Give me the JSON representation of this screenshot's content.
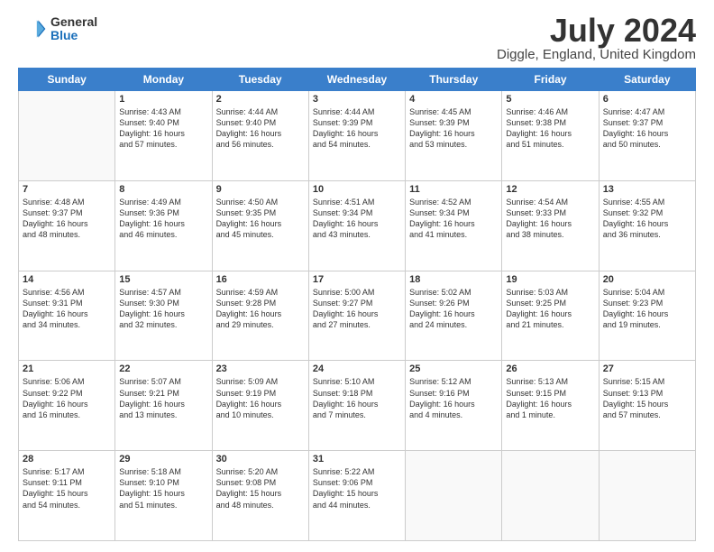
{
  "header": {
    "logo_general": "General",
    "logo_blue": "Blue",
    "title": "July 2024",
    "location": "Diggle, England, United Kingdom"
  },
  "days_of_week": [
    "Sunday",
    "Monday",
    "Tuesday",
    "Wednesday",
    "Thursday",
    "Friday",
    "Saturday"
  ],
  "weeks": [
    [
      {
        "day": "",
        "info": ""
      },
      {
        "day": "1",
        "info": "Sunrise: 4:43 AM\nSunset: 9:40 PM\nDaylight: 16 hours\nand 57 minutes."
      },
      {
        "day": "2",
        "info": "Sunrise: 4:44 AM\nSunset: 9:40 PM\nDaylight: 16 hours\nand 56 minutes."
      },
      {
        "day": "3",
        "info": "Sunrise: 4:44 AM\nSunset: 9:39 PM\nDaylight: 16 hours\nand 54 minutes."
      },
      {
        "day": "4",
        "info": "Sunrise: 4:45 AM\nSunset: 9:39 PM\nDaylight: 16 hours\nand 53 minutes."
      },
      {
        "day": "5",
        "info": "Sunrise: 4:46 AM\nSunset: 9:38 PM\nDaylight: 16 hours\nand 51 minutes."
      },
      {
        "day": "6",
        "info": "Sunrise: 4:47 AM\nSunset: 9:37 PM\nDaylight: 16 hours\nand 50 minutes."
      }
    ],
    [
      {
        "day": "7",
        "info": "Sunrise: 4:48 AM\nSunset: 9:37 PM\nDaylight: 16 hours\nand 48 minutes."
      },
      {
        "day": "8",
        "info": "Sunrise: 4:49 AM\nSunset: 9:36 PM\nDaylight: 16 hours\nand 46 minutes."
      },
      {
        "day": "9",
        "info": "Sunrise: 4:50 AM\nSunset: 9:35 PM\nDaylight: 16 hours\nand 45 minutes."
      },
      {
        "day": "10",
        "info": "Sunrise: 4:51 AM\nSunset: 9:34 PM\nDaylight: 16 hours\nand 43 minutes."
      },
      {
        "day": "11",
        "info": "Sunrise: 4:52 AM\nSunset: 9:34 PM\nDaylight: 16 hours\nand 41 minutes."
      },
      {
        "day": "12",
        "info": "Sunrise: 4:54 AM\nSunset: 9:33 PM\nDaylight: 16 hours\nand 38 minutes."
      },
      {
        "day": "13",
        "info": "Sunrise: 4:55 AM\nSunset: 9:32 PM\nDaylight: 16 hours\nand 36 minutes."
      }
    ],
    [
      {
        "day": "14",
        "info": "Sunrise: 4:56 AM\nSunset: 9:31 PM\nDaylight: 16 hours\nand 34 minutes."
      },
      {
        "day": "15",
        "info": "Sunrise: 4:57 AM\nSunset: 9:30 PM\nDaylight: 16 hours\nand 32 minutes."
      },
      {
        "day": "16",
        "info": "Sunrise: 4:59 AM\nSunset: 9:28 PM\nDaylight: 16 hours\nand 29 minutes."
      },
      {
        "day": "17",
        "info": "Sunrise: 5:00 AM\nSunset: 9:27 PM\nDaylight: 16 hours\nand 27 minutes."
      },
      {
        "day": "18",
        "info": "Sunrise: 5:02 AM\nSunset: 9:26 PM\nDaylight: 16 hours\nand 24 minutes."
      },
      {
        "day": "19",
        "info": "Sunrise: 5:03 AM\nSunset: 9:25 PM\nDaylight: 16 hours\nand 21 minutes."
      },
      {
        "day": "20",
        "info": "Sunrise: 5:04 AM\nSunset: 9:23 PM\nDaylight: 16 hours\nand 19 minutes."
      }
    ],
    [
      {
        "day": "21",
        "info": "Sunrise: 5:06 AM\nSunset: 9:22 PM\nDaylight: 16 hours\nand 16 minutes."
      },
      {
        "day": "22",
        "info": "Sunrise: 5:07 AM\nSunset: 9:21 PM\nDaylight: 16 hours\nand 13 minutes."
      },
      {
        "day": "23",
        "info": "Sunrise: 5:09 AM\nSunset: 9:19 PM\nDaylight: 16 hours\nand 10 minutes."
      },
      {
        "day": "24",
        "info": "Sunrise: 5:10 AM\nSunset: 9:18 PM\nDaylight: 16 hours\nand 7 minutes."
      },
      {
        "day": "25",
        "info": "Sunrise: 5:12 AM\nSunset: 9:16 PM\nDaylight: 16 hours\nand 4 minutes."
      },
      {
        "day": "26",
        "info": "Sunrise: 5:13 AM\nSunset: 9:15 PM\nDaylight: 16 hours\nand 1 minute."
      },
      {
        "day": "27",
        "info": "Sunrise: 5:15 AM\nSunset: 9:13 PM\nDaylight: 15 hours\nand 57 minutes."
      }
    ],
    [
      {
        "day": "28",
        "info": "Sunrise: 5:17 AM\nSunset: 9:11 PM\nDaylight: 15 hours\nand 54 minutes."
      },
      {
        "day": "29",
        "info": "Sunrise: 5:18 AM\nSunset: 9:10 PM\nDaylight: 15 hours\nand 51 minutes."
      },
      {
        "day": "30",
        "info": "Sunrise: 5:20 AM\nSunset: 9:08 PM\nDaylight: 15 hours\nand 48 minutes."
      },
      {
        "day": "31",
        "info": "Sunrise: 5:22 AM\nSunset: 9:06 PM\nDaylight: 15 hours\nand 44 minutes."
      },
      {
        "day": "",
        "info": ""
      },
      {
        "day": "",
        "info": ""
      },
      {
        "day": "",
        "info": ""
      }
    ]
  ]
}
